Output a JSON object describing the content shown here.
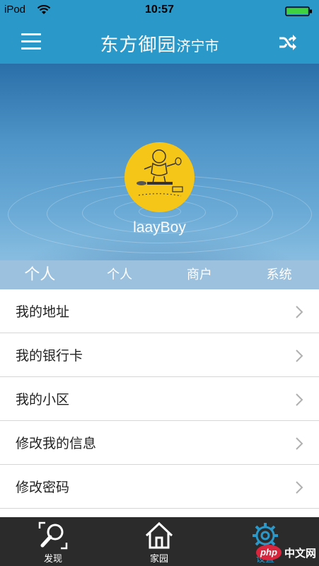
{
  "status_bar": {
    "carrier": "iPod",
    "time": "10:57"
  },
  "header": {
    "title_main": "东方御园",
    "title_sub": "济宁市"
  },
  "profile": {
    "username": "laayBoy"
  },
  "tabs": [
    {
      "label": "个人"
    },
    {
      "label": "个人"
    },
    {
      "label": "商户"
    },
    {
      "label": "系统"
    }
  ],
  "menu_items": [
    {
      "label": "我的地址"
    },
    {
      "label": "我的银行卡"
    },
    {
      "label": "我的小区"
    },
    {
      "label": "修改我的信息"
    },
    {
      "label": "修改密码"
    }
  ],
  "tabbar": [
    {
      "label": "发现",
      "icon": "search-icon"
    },
    {
      "label": "家园",
      "icon": "home-icon"
    },
    {
      "label": "设置",
      "icon": "gear-icon"
    }
  ],
  "watermark": {
    "badge": "php",
    "text": "中文网"
  },
  "colors": {
    "header": "#2a98c9",
    "tab_strip": "#96bedc",
    "tabbar": "#2b2b2b",
    "avatar_bg": "#f5c518"
  }
}
